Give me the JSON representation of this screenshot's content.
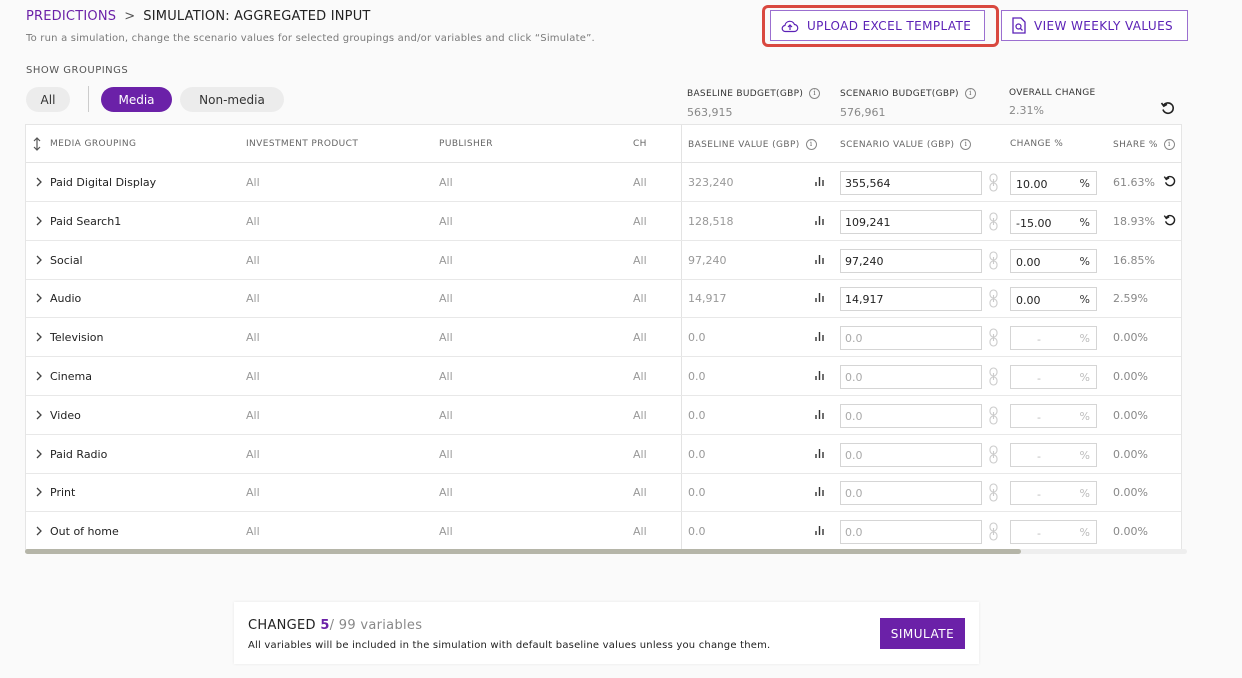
{
  "breadcrumb": {
    "parent": "PREDICTIONS",
    "separator": ">",
    "current": "SIMULATION: AGGREGATED INPUT"
  },
  "subtitle": "To run a simulation, change the scenario values for selected groupings and/or variables and click “Simulate”.",
  "actions": {
    "upload": "UPLOAD EXCEL TEMPLATE",
    "weekly": "VIEW WEEKLY VALUES"
  },
  "groupings": {
    "label": "SHOW GROUPINGS",
    "all": "All",
    "media": "Media",
    "nonmedia": "Non-media",
    "active": "Media"
  },
  "summary": {
    "baseline_label": "BASELINE BUDGET(GBP)",
    "baseline_value": "563,915",
    "scenario_label": "SCENARIO BUDGET(GBP)",
    "scenario_value": "576,961",
    "overall_label": "OVERALL CHANGE",
    "overall_value": "2.31%"
  },
  "columns": {
    "media_grouping": "MEDIA GROUPING",
    "investment_product": "INVESTMENT PRODUCT",
    "publisher": "PUBLISHER",
    "ch": "CH",
    "baseline_value": "BASELINE VALUE (GBP)",
    "scenario_value": "SCENARIO VALUE (GBP)",
    "change": "CHANGE %",
    "share": "SHARE %"
  },
  "rows": [
    {
      "name": "Paid Digital Display",
      "product": "All",
      "publisher": "All",
      "ch": "All",
      "baseline": "323,240",
      "scenario": "355,564",
      "change": "10.00",
      "pct": "%",
      "share": "61.63%",
      "reset": true
    },
    {
      "name": "Paid Search1",
      "product": "All",
      "publisher": "All",
      "ch": "All",
      "baseline": "128,518",
      "scenario": "109,241",
      "change": "-15.00",
      "pct": "%",
      "share": "18.93%",
      "reset": true
    },
    {
      "name": "Social",
      "product": "All",
      "publisher": "All",
      "ch": "All",
      "baseline": "97,240",
      "scenario": "97,240",
      "change": "0.00",
      "pct": "%",
      "share": "16.85%",
      "reset": false
    },
    {
      "name": "Audio",
      "product": "All",
      "publisher": "All",
      "ch": "All",
      "baseline": "14,917",
      "scenario": "14,917",
      "change": "0.00",
      "pct": "%",
      "share": "2.59%",
      "reset": false
    },
    {
      "name": "Television",
      "product": "All",
      "publisher": "All",
      "ch": "All",
      "baseline": "0.0",
      "scenario": "0.0",
      "change": "-",
      "pct": "%",
      "share": "0.00%",
      "reset": false,
      "disabled": true
    },
    {
      "name": "Cinema",
      "product": "All",
      "publisher": "All",
      "ch": "All",
      "baseline": "0.0",
      "scenario": "0.0",
      "change": "-",
      "pct": "%",
      "share": "0.00%",
      "reset": false,
      "disabled": true
    },
    {
      "name": "Video",
      "product": "All",
      "publisher": "All",
      "ch": "All",
      "baseline": "0.0",
      "scenario": "0.0",
      "change": "-",
      "pct": "%",
      "share": "0.00%",
      "reset": false,
      "disabled": true
    },
    {
      "name": "Paid Radio",
      "product": "All",
      "publisher": "All",
      "ch": "All",
      "baseline": "0.0",
      "scenario": "0.0",
      "change": "-",
      "pct": "%",
      "share": "0.00%",
      "reset": false,
      "disabled": true
    },
    {
      "name": "Print",
      "product": "All",
      "publisher": "All",
      "ch": "All",
      "baseline": "0.0",
      "scenario": "0.0",
      "change": "-",
      "pct": "%",
      "share": "0.00%",
      "reset": false,
      "disabled": true
    },
    {
      "name": "Out of home",
      "product": "All",
      "publisher": "All",
      "ch": "All",
      "baseline": "0.0",
      "scenario": "0.0",
      "change": "-",
      "pct": "%",
      "share": "0.00%",
      "reset": false,
      "disabled": true
    }
  ],
  "footer": {
    "changed_label": "CHANGED",
    "changed_count": "5",
    "changed_total": "/ 99 variables",
    "note": "All variables will be included in the simulation with default baseline values unless you change them.",
    "simulate": "SIMULATE"
  },
  "colors": {
    "accent": "#6b21a8",
    "highlight": "#d9483f"
  }
}
